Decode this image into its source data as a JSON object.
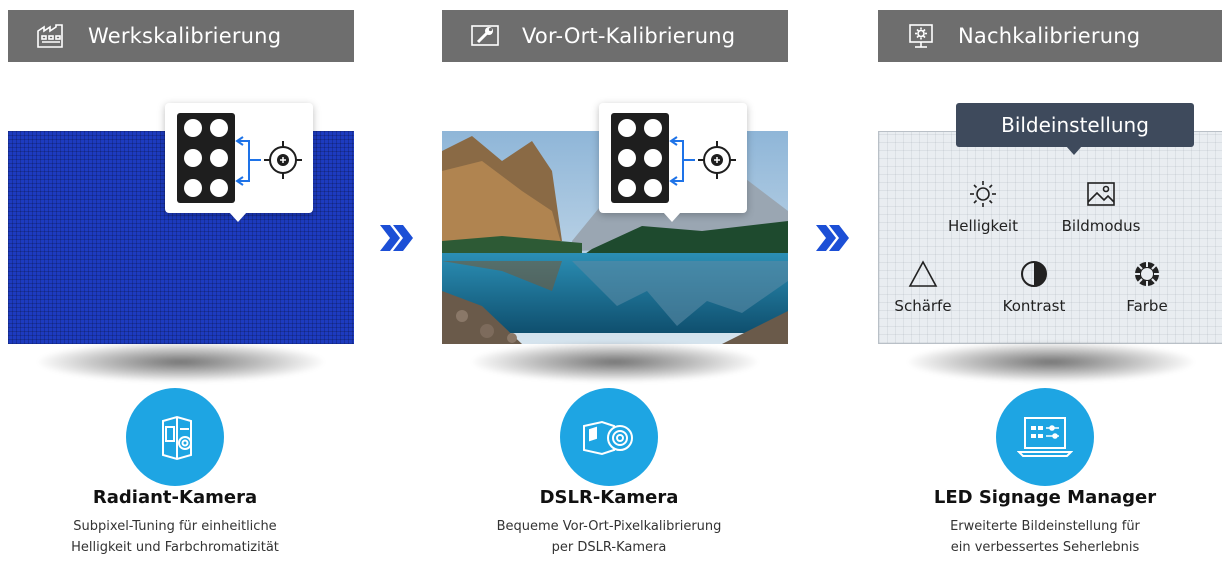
{
  "steps": [
    {
      "title": "Werkskalibrierung",
      "icon": "factory-icon",
      "caption_title": "Radiant-Kamera",
      "caption_line1": "Subpixel-Tuning für einheitliche",
      "caption_line2": "Helligkeit und Farbchromatizität",
      "circle_icon": "camera-box-icon"
    },
    {
      "title": "Vor-Ort-Kalibrierung",
      "icon": "tool-screen-icon",
      "caption_title": "DSLR-Kamera",
      "caption_line1": "Bequeme Vor-Ort-Pixelkalibrierung",
      "caption_line2": "per DSLR-Kamera",
      "circle_icon": "dslr-camera-icon"
    },
    {
      "title": "Nachkalibrierung",
      "icon": "monitor-settings-icon",
      "caption_title": "LED Signage Manager",
      "caption_line1": "Erweiterte Bildeinstellung für",
      "caption_line2": "ein verbessertes Seherlebnis",
      "circle_icon": "laptop-icon"
    }
  ],
  "picture_settings": {
    "tooltip": "Bildeinstellung",
    "items": [
      "Helligkeit",
      "Bildmodus",
      "Schärfe",
      "Kontrast",
      "Farbe"
    ]
  },
  "colors": {
    "header_bg": "#6e6e6e",
    "accent_blue": "#1ea5e3",
    "chevron_blue": "#1c4fd6",
    "screen_blue": "#1d3bbf",
    "tooltip_bg": "#3e4a5c"
  }
}
